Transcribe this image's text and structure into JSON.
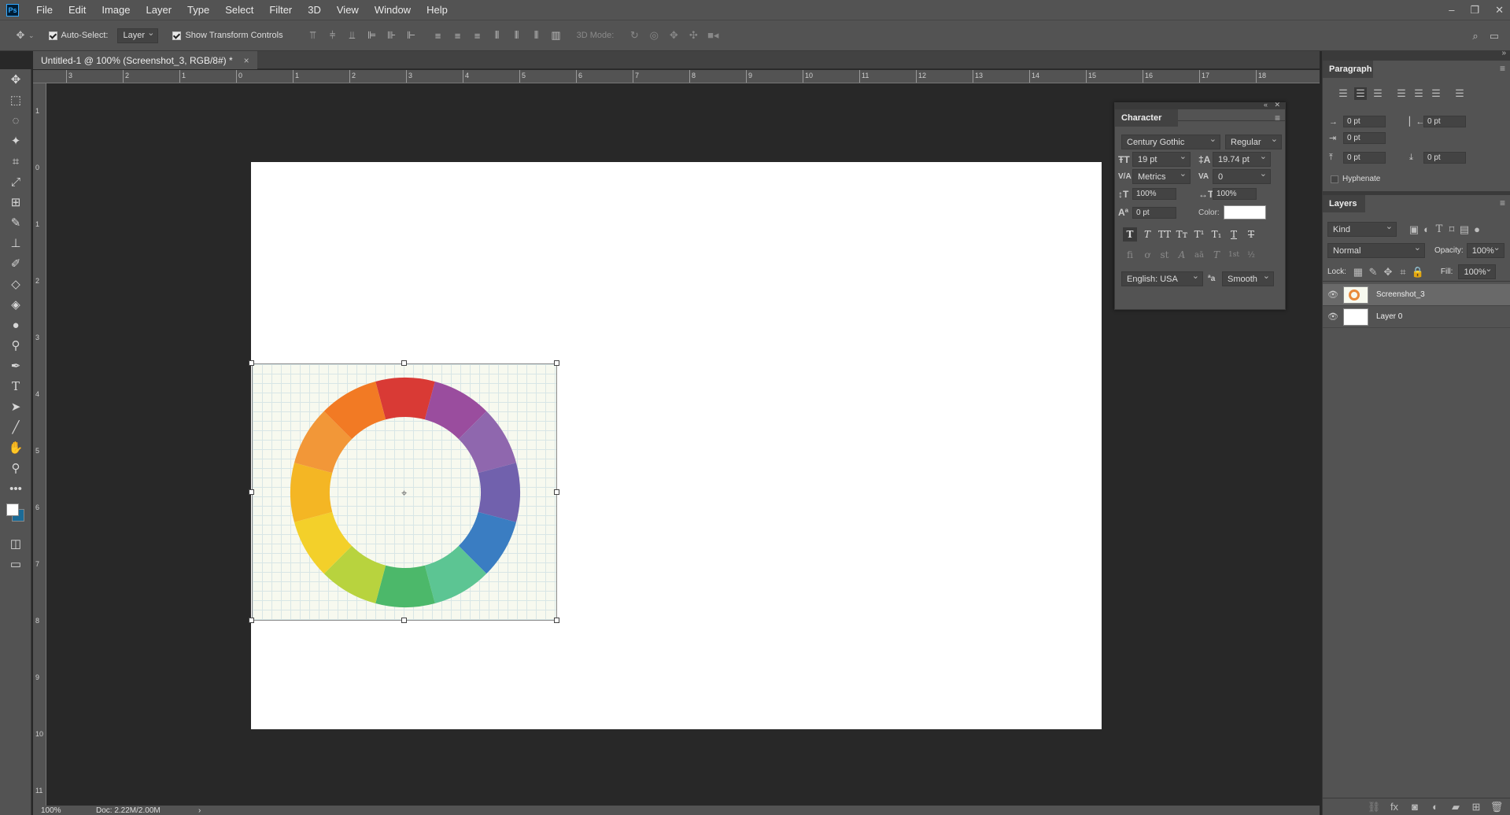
{
  "app": {
    "logo": "Ps"
  },
  "menu": [
    "File",
    "Edit",
    "Image",
    "Layer",
    "Type",
    "Select",
    "Filter",
    "3D",
    "View",
    "Window",
    "Help"
  ],
  "window_controls": [
    "–",
    "❐",
    "✕"
  ],
  "options": {
    "auto_select_label": "Auto-Select:",
    "auto_select_value": "Layer",
    "show_transform_label": "Show Transform Controls",
    "mode_3d_label": "3D Mode:"
  },
  "document_tab": {
    "title": "Untitled-1 @ 100% (Screenshot_3, RGB/8#) *",
    "close": "×"
  },
  "ruler_h": [
    "3",
    "2",
    "1",
    "0",
    "1",
    "2",
    "3",
    "4",
    "5",
    "6",
    "7",
    "8",
    "9",
    "10",
    "11",
    "12",
    "13",
    "14",
    "15",
    "16",
    "17",
    "18"
  ],
  "ruler_v": [
    "1",
    "0",
    "1",
    "2",
    "3",
    "4",
    "5",
    "6",
    "7",
    "8",
    "9",
    "10",
    "11"
  ],
  "status": {
    "zoom": "100%",
    "doc": "Doc: 2.22M/2.00M",
    "arrow": "›"
  },
  "paragraph": {
    "title": "Paragraph",
    "indent_left": "0 pt",
    "indent_right": "0 pt",
    "indent_first": "0 pt",
    "space_before": "0 pt",
    "space_after": "0 pt",
    "hyphenate_label": "Hyphenate"
  },
  "character": {
    "title": "Character",
    "font_family": "Century Gothic",
    "font_style": "Regular",
    "size": "19 pt",
    "leading": "19.74 pt",
    "kerning": "Metrics",
    "tracking": "0",
    "vscale": "100%",
    "hscale": "100%",
    "baseline": "0 pt",
    "color_label": "Color:",
    "color_value": "#ffffff",
    "type_buttons": [
      "T",
      "T",
      "TT",
      "Tт",
      "T¹",
      "T₁",
      "T",
      "T"
    ],
    "opentype_buttons": [
      "ﬁ",
      "ơ",
      "st",
      "A",
      "aā",
      "T",
      "1st",
      "½"
    ],
    "language": "English: USA",
    "antialias_icon": "ªa",
    "antialias": "Smooth"
  },
  "layers": {
    "title": "Layers",
    "filter": "Kind",
    "blend_mode": "Normal",
    "opacity_label": "Opacity:",
    "opacity": "100%",
    "lock_label": "Lock:",
    "fill_label": "Fill:",
    "fill": "100%",
    "items": [
      {
        "name": "Screenshot_3",
        "selected": true
      },
      {
        "name": "Layer 0",
        "selected": false
      }
    ]
  },
  "color_wheel": {
    "segments": [
      "#d93a35",
      "#9a4d9e",
      "#8f67ae",
      "#7161ad",
      "#3a7dc2",
      "#5cc593",
      "#4cb86a",
      "#b8d33e",
      "#f3d02a",
      "#f4b624",
      "#f29738",
      "#f27a24"
    ]
  },
  "icons": {
    "move": "move-icon",
    "marquee": "marquee-icon",
    "lasso": "lasso-icon",
    "wand": "magic-wand-icon",
    "crop": "crop-icon",
    "eyedropper": "eyedropper-icon",
    "patch": "patch-icon",
    "brush": "brush-icon",
    "stamp": "stamp-icon",
    "history": "history-brush-icon",
    "eraser": "eraser-icon",
    "bucket": "paint-bucket-icon",
    "blur": "blur-icon",
    "dodge": "dodge-icon",
    "pen": "pen-icon",
    "type": "type-icon",
    "path": "path-select-icon",
    "line": "line-icon",
    "hand": "hand-icon",
    "zoom": "zoom-icon",
    "more": "more-icon"
  }
}
